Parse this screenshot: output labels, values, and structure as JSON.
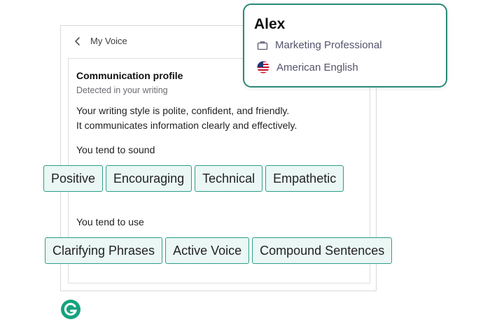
{
  "panel": {
    "title": "My Voice"
  },
  "card": {
    "heading": "Communication profile",
    "subheading": "Detected in your writing",
    "description_line1": "Your writing style is polite, confident, and friendly.",
    "description_line2": "It communicates information clearly and effectively.",
    "sound_label": "You tend to sound",
    "sound_tags": [
      "Positive",
      "Encouraging",
      "Technical",
      "Empathetic"
    ],
    "use_label": "You tend to use",
    "use_tags": [
      "Clarifying Phrases",
      "Active Voice",
      "Compound Sentences"
    ]
  },
  "profile": {
    "name": "Alex",
    "role": "Marketing Professional",
    "language": "American English",
    "role_icon": "briefcase-icon",
    "language_icon": "us-flag-icon",
    "border_color": "#2a8a77"
  },
  "colors": {
    "chip_border": "#2e9f89",
    "chip_fill": "#eaf7f4",
    "logo": "#15a37f"
  }
}
